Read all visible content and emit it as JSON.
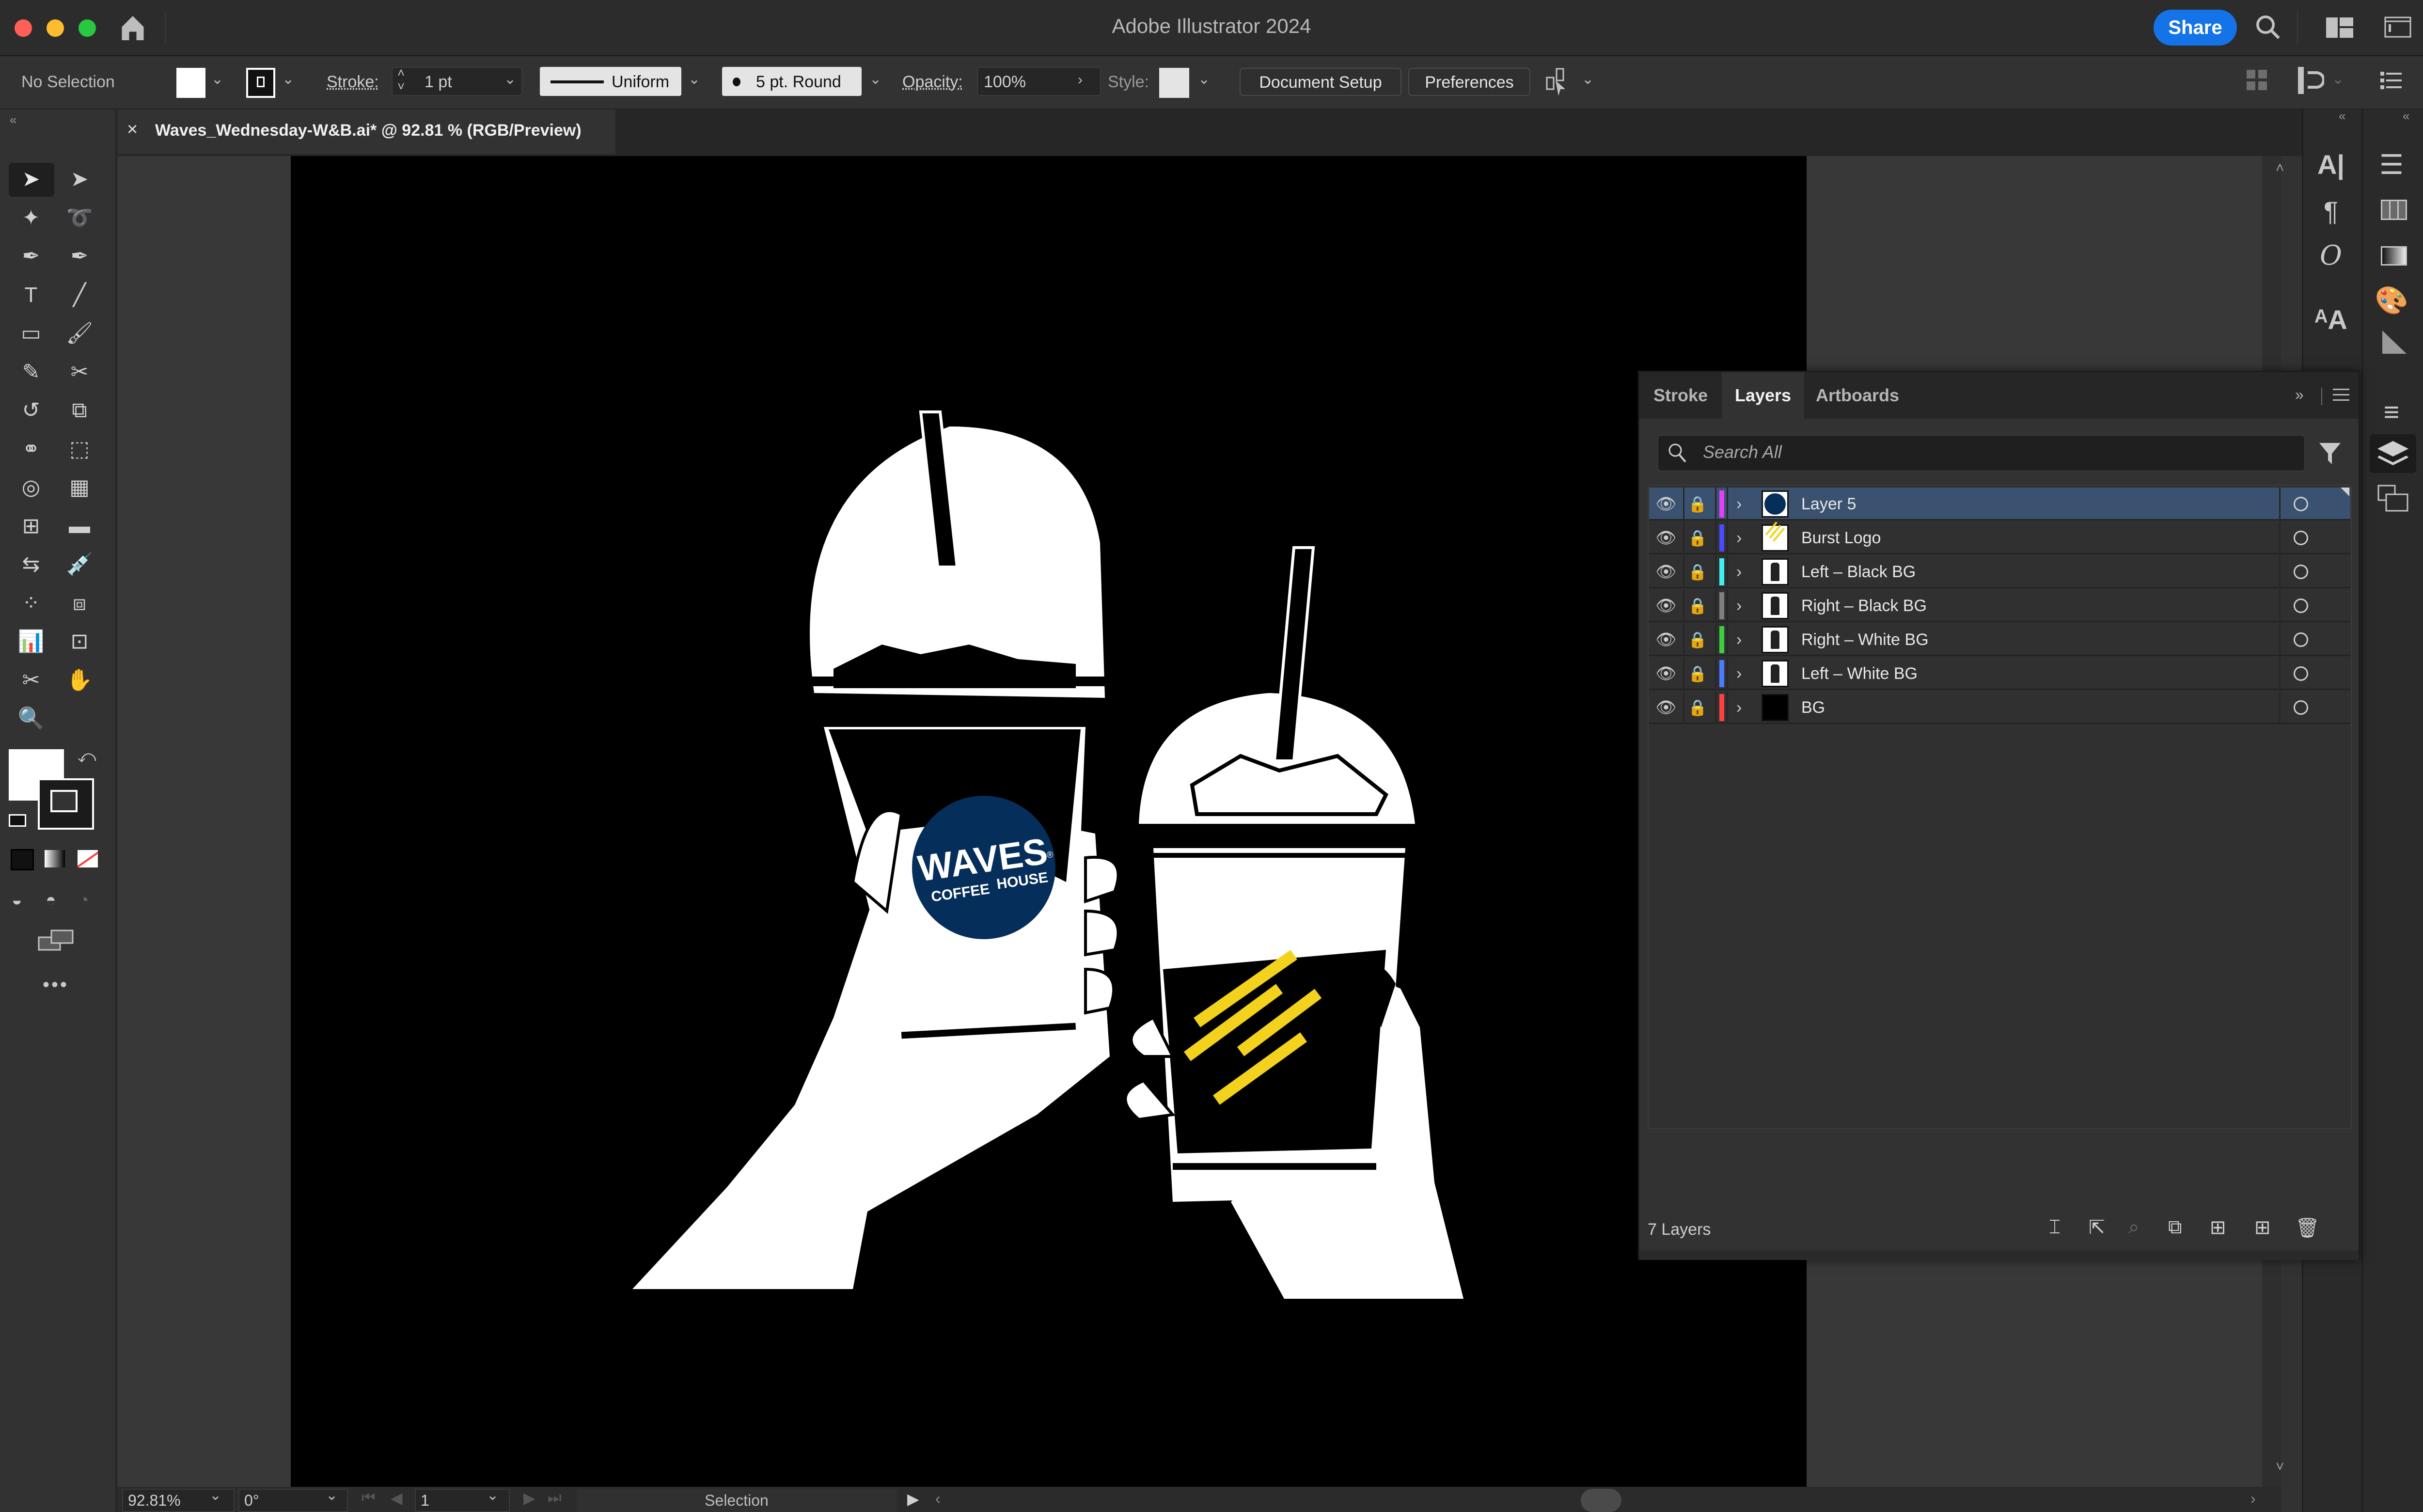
{
  "window": {
    "title": "Adobe Illustrator 2024",
    "share_label": "Share",
    "traffic_colors": {
      "close": "#ff5f57",
      "minimize": "#febc2e",
      "maximize": "#28c840"
    }
  },
  "control_bar": {
    "selection_status": "No Selection",
    "fill_color": "#ffffff",
    "stroke_label": "Stroke:",
    "stroke_weight": "1 pt",
    "stroke_profile": "Uniform",
    "brush": "5 pt. Round",
    "opacity_label": "Opacity:",
    "opacity_value": "100%",
    "style_label": "Style:",
    "document_setup_label": "Document Setup",
    "preferences_label": "Preferences"
  },
  "document_tab": {
    "close_glyph": "×",
    "label": "Waves_Wednesday-W&B.ai* @ 92.81 % (RGB/Preview)"
  },
  "tools": [
    "selection-tool",
    "direct-selection-tool",
    "magic-wand-tool",
    "lasso-tool",
    "pen-tool",
    "curvature-tool",
    "type-tool",
    "line-segment-tool",
    "rectangle-tool",
    "paintbrush-tool",
    "shaper-tool",
    "scissors-tool",
    "rotate-tool",
    "scale-tool",
    "width-tool",
    "free-transform-tool",
    "shape-builder-tool",
    "perspective-grid-tool",
    "mesh-tool",
    "gradient-tool",
    "blend-tool",
    "eyedropper-tool",
    "symbol-sprayer-tool",
    "live-paint-selection-tool",
    "column-graph-tool",
    "artboard-tool",
    "slice-tool",
    "hand-tool",
    "zoom-tool"
  ],
  "artwork": {
    "logo_line1": "WAVES",
    "logo_line2": "COFFEE",
    "logo_line3": "HOUSE",
    "logo_reg": "®",
    "logo_color": "#062e5a",
    "burst_color": "#f2d21c"
  },
  "status_bar": {
    "zoom": "92.81%",
    "rotation": "0°",
    "artboard_number": "1",
    "current_tool": "Selection"
  },
  "layers_panel": {
    "tabs": [
      {
        "label": "Stroke",
        "active": false
      },
      {
        "label": "Layers",
        "active": true
      },
      {
        "label": "Artboards",
        "active": false
      }
    ],
    "search_placeholder": "Search All",
    "layers": [
      {
        "name": "Layer 5",
        "color": "#e040fb",
        "selected": true,
        "thumb": "waves-logo"
      },
      {
        "name": "Burst Logo",
        "color": "#4a4aff",
        "selected": false,
        "thumb": "burst"
      },
      {
        "name": "Left – Black BG",
        "color": "#40f0f0",
        "selected": false,
        "thumb": "cup"
      },
      {
        "name": "Right – Black BG",
        "color": "#808080",
        "selected": false,
        "thumb": "cup"
      },
      {
        "name": "Right – White BG",
        "color": "#3ccf3c",
        "selected": false,
        "thumb": "cup"
      },
      {
        "name": "Left – White BG",
        "color": "#4a7cff",
        "selected": false,
        "thumb": "cup"
      },
      {
        "name": "BG",
        "color": "#ff4040",
        "selected": false,
        "thumb": "black"
      }
    ],
    "layer_count": "7 Layers"
  }
}
